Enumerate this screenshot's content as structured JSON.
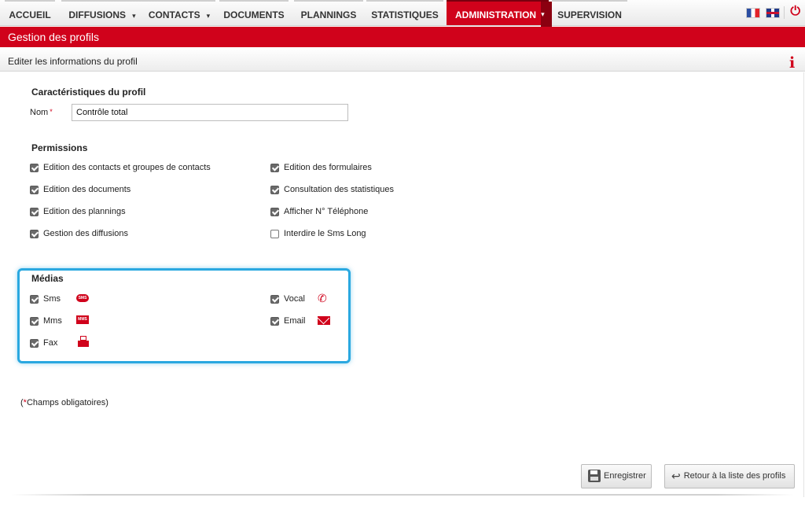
{
  "nav": {
    "tabs": [
      {
        "label": "ACCUEIL",
        "dropdown": false
      },
      {
        "label": "DIFFUSIONS",
        "dropdown": true
      },
      {
        "label": "CONTACTS",
        "dropdown": true
      },
      {
        "label": "DOCUMENTS",
        "dropdown": false
      },
      {
        "label": "PLANNINGS",
        "dropdown": false
      },
      {
        "label": "STATISTIQUES",
        "dropdown": false
      },
      {
        "label": "ADMINISTRATION",
        "dropdown": true,
        "active": true
      },
      {
        "label": "SUPERVISION",
        "dropdown": false
      }
    ],
    "caret": "▾",
    "icons": [
      "flag-fr-icon",
      "flag-uk-icon",
      "power-icon"
    ]
  },
  "page": {
    "title": "Gestion des profils",
    "subtitle": "Editer les informations du profil",
    "info_icon": "i"
  },
  "profile": {
    "section_title": "Caractéristiques du profil",
    "name_label": "Nom",
    "required_mark": "*",
    "name_value": "Contrôle total"
  },
  "permissions": {
    "section_title": "Permissions",
    "left": [
      {
        "label": "Edition des contacts et groupes de contacts",
        "checked": true
      },
      {
        "label": "Edition des documents",
        "checked": true
      },
      {
        "label": "Edition des plannings",
        "checked": true
      },
      {
        "label": "Gestion des diffusions",
        "checked": true
      }
    ],
    "right": [
      {
        "label": "Edition des formulaires",
        "checked": true
      },
      {
        "label": "Consultation des statistiques",
        "checked": true
      },
      {
        "label": "Afficher N° Téléphone",
        "checked": true
      },
      {
        "label": "Interdire le Sms Long",
        "checked": false
      }
    ]
  },
  "medias": {
    "section_title": "Médias",
    "items": [
      {
        "label": "Sms",
        "checked": true,
        "icon": "sms-icon",
        "icon_text": "SMS"
      },
      {
        "label": "Mms",
        "checked": true,
        "icon": "mms-icon",
        "icon_text": "MMS"
      },
      {
        "label": "Fax",
        "checked": true,
        "icon": "fax-icon",
        "icon_text": ""
      },
      {
        "label": "Vocal",
        "checked": true,
        "icon": "phone-icon",
        "icon_text": ""
      },
      {
        "label": "Email",
        "checked": true,
        "icon": "email-icon",
        "icon_text": ""
      }
    ],
    "highlight_color": "#2aa8e0"
  },
  "footer": {
    "mandatory_prefix": "(",
    "mandatory_mark": "*",
    "mandatory_text": "Champs obligatoires)",
    "save_label": "Enregistrer",
    "back_label": "Retour à la liste des profils"
  },
  "colors": {
    "accent": "#d0021b",
    "accent_dark": "#8b0010"
  }
}
